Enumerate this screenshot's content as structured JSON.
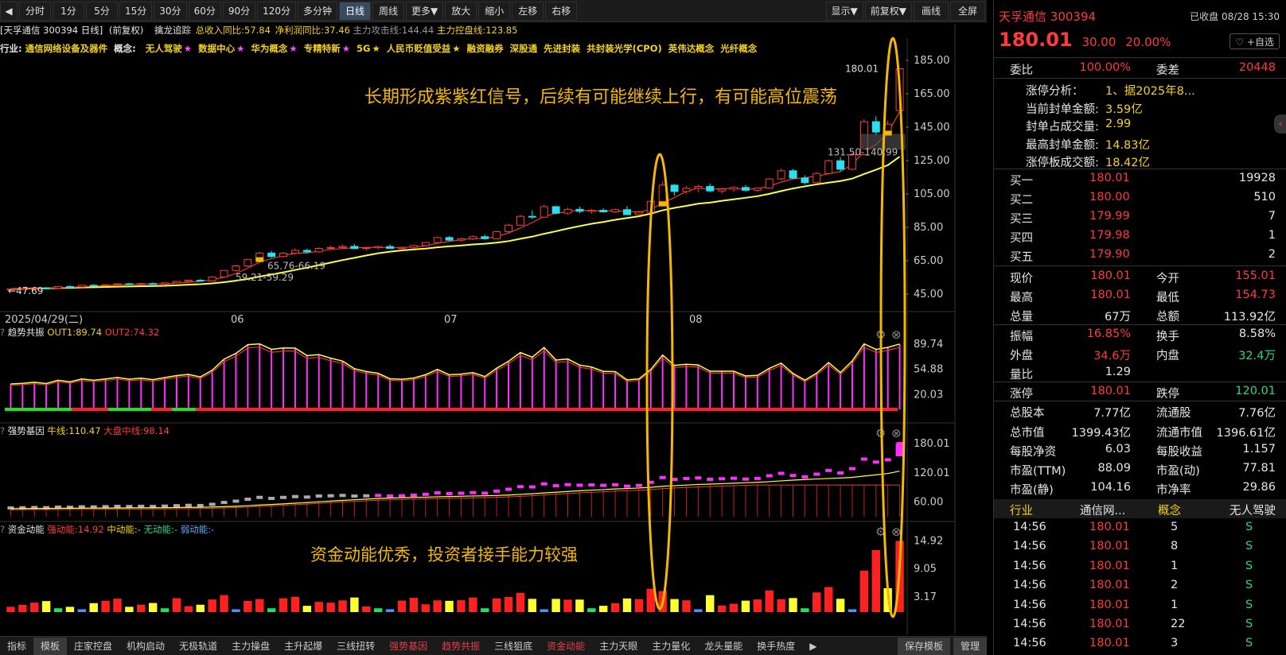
{
  "toolbar": {
    "items": [
      "分时",
      "1分",
      "5分",
      "15分",
      "30分",
      "60分",
      "90分",
      "120分",
      "多分钟",
      "日线",
      "周线",
      "更多▼",
      "放大",
      "缩小",
      "左移",
      "右移"
    ],
    "active": "日线",
    "right_items": [
      "显示▼",
      "前复权▼",
      "画线",
      "全屏"
    ]
  },
  "info": {
    "title": "[天孚通信 300394 日线]",
    "fq": "(前复权)",
    "indicator": "擒龙追踪",
    "rev": "总收入同比:57.84",
    "profit": "净利润同比:37.46",
    "attack": "主力攻击线:144.44",
    "control": "主力控盘线:123.85"
  },
  "categories": {
    "industry_label": "行业:",
    "industry": "通信网络设备及器件",
    "concept_label": "概念:",
    "concepts": [
      {
        "t": "无人驾驶",
        "s": "★",
        "c": "#ff4cff"
      },
      {
        "t": "数据中心",
        "s": "★",
        "c": "#ff4cff"
      },
      {
        "t": "华为概念",
        "s": "★",
        "c": "#ff4cff"
      },
      {
        "t": "专精特新",
        "s": "★",
        "c": "#ff4cff"
      },
      {
        "t": "5G",
        "s": "★",
        "c": "#f5d21a"
      },
      {
        "t": "人民币贬值受益",
        "s": "★",
        "c": "#f5d21a"
      },
      {
        "t": "融资融券",
        "s": "",
        "c": ""
      },
      {
        "t": "深股通",
        "s": "",
        "c": ""
      },
      {
        "t": "先进封装",
        "s": "",
        "c": ""
      },
      {
        "t": "共封装光学(CPO)",
        "s": "",
        "c": ""
      },
      {
        "t": "英伟达概念",
        "s": "",
        "c": ""
      },
      {
        "t": "光纤概念",
        "s": "",
        "c": ""
      }
    ]
  },
  "main_chart": {
    "y_ticks": [
      "185.00",
      "165.00",
      "145.00",
      "125.00",
      "105.00",
      "85.00",
      "65.00",
      "45.00"
    ],
    "x_ticks": [
      "2025/04/29(二)",
      "06",
      "07",
      "08"
    ],
    "annotations": {
      "high": "180.01",
      "box": "131.50-140.99",
      "mid1": "65.76-66.19",
      "mid2": "59.21-59.29",
      "low": "47.69"
    },
    "note": "长期形成紫紫红信号，后续有可能继续上行，有可能高位震荡"
  },
  "chart_data": {
    "type": "candlestick",
    "series": [
      {
        "name": "K",
        "ohlc": [
          [
            47.7,
            48.2,
            47.3,
            48.0
          ],
          [
            48.0,
            48.6,
            47.6,
            48.3
          ],
          [
            48.3,
            49.0,
            47.9,
            48.8
          ],
          [
            48.8,
            49.2,
            48.2,
            48.5
          ],
          [
            48.5,
            49.8,
            48.3,
            49.6
          ],
          [
            49.6,
            50.2,
            49.0,
            49.3
          ],
          [
            49.3,
            50.6,
            49.0,
            50.3
          ],
          [
            50.3,
            51.0,
            49.8,
            50.1
          ],
          [
            50.1,
            50.8,
            49.6,
            50.6
          ],
          [
            50.6,
            51.5,
            50.1,
            51.2
          ],
          [
            51.2,
            51.8,
            50.6,
            50.9
          ],
          [
            50.9,
            51.6,
            50.3,
            51.3
          ],
          [
            51.3,
            52.0,
            50.8,
            51.0
          ],
          [
            51.0,
            51.9,
            50.6,
            51.7
          ],
          [
            51.7,
            52.8,
            51.3,
            52.6
          ],
          [
            52.6,
            53.6,
            52.2,
            53.3
          ],
          [
            53.3,
            54.0,
            52.6,
            52.9
          ],
          [
            52.9,
            55.8,
            52.5,
            55.3
          ],
          [
            55.3,
            59.3,
            55.0,
            59.2
          ],
          [
            59.2,
            62.5,
            58.5,
            61.9
          ],
          [
            61.9,
            66.2,
            61.3,
            65.8
          ],
          [
            65.8,
            70.5,
            65.2,
            69.6
          ],
          [
            69.6,
            71.0,
            66.8,
            67.5
          ],
          [
            67.5,
            70.2,
            66.9,
            69.5
          ],
          [
            69.5,
            72.4,
            68.6,
            71.2
          ],
          [
            71.2,
            72.2,
            69.6,
            70.3
          ],
          [
            70.3,
            73.0,
            69.8,
            72.4
          ],
          [
            72.4,
            74.0,
            71.5,
            72.9
          ],
          [
            72.9,
            74.5,
            72.1,
            73.6
          ],
          [
            73.6,
            75.0,
            72.8,
            72.3
          ],
          [
            72.3,
            73.4,
            71.0,
            72.8
          ],
          [
            72.8,
            74.0,
            71.9,
            73.5
          ],
          [
            73.5,
            74.8,
            72.6,
            72.4
          ],
          [
            72.4,
            73.5,
            71.5,
            73.0
          ],
          [
            73.0,
            74.5,
            72.2,
            74.1
          ],
          [
            74.1,
            76.2,
            73.6,
            75.9
          ],
          [
            75.9,
            79.5,
            75.4,
            78.9
          ],
          [
            78.9,
            79.8,
            76.8,
            77.3
          ],
          [
            77.3,
            78.8,
            76.5,
            78.1
          ],
          [
            78.1,
            80.0,
            77.4,
            79.4
          ],
          [
            79.4,
            80.6,
            77.8,
            78.2
          ],
          [
            78.2,
            82.8,
            77.9,
            82.4
          ],
          [
            82.4,
            87.2,
            82.0,
            86.3
          ],
          [
            86.3,
            92.5,
            85.9,
            91.6
          ],
          [
            91.6,
            95.2,
            90.0,
            91.1
          ],
          [
            91.1,
            98.6,
            90.5,
            97.4
          ],
          [
            97.4,
            98.0,
            92.8,
            93.5
          ],
          [
            93.5,
            96.8,
            92.6,
            95.8
          ],
          [
            95.8,
            97.4,
            93.5,
            94.6
          ],
          [
            94.6,
            96.0,
            93.0,
            95.2
          ],
          [
            95.2,
            96.5,
            93.8,
            94.3
          ],
          [
            94.3,
            96.2,
            93.6,
            95.6
          ],
          [
            95.6,
            97.8,
            94.9,
            92.6
          ],
          [
            92.6,
            95.0,
            91.8,
            94.1
          ],
          [
            94.1,
            101.2,
            93.5,
            100.6
          ],
          [
            100.6,
            112.4,
            98.5,
            110.3
          ],
          [
            110.3,
            111.0,
            104.0,
            106.5
          ],
          [
            106.5,
            109.8,
            105.2,
            108.4
          ],
          [
            108.4,
            110.6,
            106.0,
            109.5
          ],
          [
            109.5,
            111.2,
            105.9,
            106.8
          ],
          [
            106.8,
            108.5,
            105.2,
            107.9
          ],
          [
            107.9,
            109.6,
            106.3,
            108.9
          ],
          [
            108.9,
            110.4,
            106.5,
            107.2
          ],
          [
            107.2,
            109.0,
            106.2,
            108.5
          ],
          [
            108.5,
            114.6,
            108.0,
            114.0
          ],
          [
            114.0,
            120.2,
            113.2,
            118.9
          ],
          [
            118.9,
            120.0,
            113.8,
            114.5
          ],
          [
            114.5,
            116.2,
            110.6,
            111.8
          ],
          [
            111.8,
            118.0,
            111.0,
            117.3
          ],
          [
            117.3,
            125.6,
            116.8,
            124.9
          ],
          [
            124.9,
            127.0,
            118.5,
            119.8
          ],
          [
            119.8,
            129.8,
            119.1,
            128.6
          ],
          [
            128.6,
            149.8,
            128.0,
            148.3
          ],
          [
            148.3,
            151.5,
            140.2,
            142.1
          ],
          [
            142.1,
            149.0,
            141.0,
            146.8
          ],
          [
            155.0,
            180.0,
            154.7,
            180.0
          ]
        ]
      },
      {
        "name": "MA5",
        "values": []
      },
      {
        "name": "MA20",
        "values": []
      }
    ],
    "ylim": [
      40,
      190
    ]
  },
  "panes": {
    "trend": {
      "title": "趋势共振",
      "out1": "OUT1:89.74",
      "out2": "OUT2:74.32",
      "ticks": [
        "89.74",
        "54.88",
        "20.03"
      ]
    },
    "gene": {
      "title": "强势基因",
      "bull": "牛线:110.47",
      "market": "大盘中线:98.14",
      "ticks": [
        "180.01",
        "120.01",
        "60.00"
      ]
    },
    "fund": {
      "title": "资金动能",
      "strong": "强动能:14.92",
      "mid": "中动能:-",
      "none": "无动能:-",
      "weak": "弱动能:-",
      "ticks": [
        "14.92",
        "9.05",
        "3.17"
      ],
      "note": "资金动能优秀，投资者接手能力较强"
    }
  },
  "bottom_tabs": [
    "指标",
    "模板",
    "庄家控盘",
    "机构启动",
    "无极轨道",
    "主力操盘",
    "主升起爆",
    "三线扭转",
    "强势基因",
    "趋势共振",
    "三线狙底",
    "资金动能",
    "主力天眼",
    "主力量化",
    "龙头量能",
    "换手热度"
  ],
  "bottom_red": [
    "强势基因",
    "趋势共振",
    "资金动能"
  ],
  "bottom_right": [
    "保存模板",
    "管理"
  ],
  "quote": {
    "name": "天孚通信",
    "code": "300394",
    "status": "已收盘",
    "time": "08/28 15:30",
    "price": "180.01",
    "change": "30.00",
    "pct": "20.00%",
    "fav": "♡ +自选",
    "webi_label": "委比",
    "webi": "100.00%",
    "wecha_label": "委差",
    "wecha": "20448",
    "limit_analysis": [
      {
        "k": "涨停分析：",
        "v": "1、据2025年8..."
      },
      {
        "k": "当前封单金额:",
        "v": "3.59亿"
      },
      {
        "k": "封单占成交量:",
        "v": "2.99"
      },
      {
        "k": "最高封单金额:",
        "v": "14.83亿"
      },
      {
        "k": "涨停板成交额:",
        "v": "18.42亿"
      }
    ],
    "bids": [
      {
        "k": "买一",
        "p": "180.01",
        "v": "19928"
      },
      {
        "k": "买二",
        "p": "180.00",
        "v": "510"
      },
      {
        "k": "买三",
        "p": "179.99",
        "v": "7"
      },
      {
        "k": "买四",
        "p": "179.98",
        "v": "1"
      },
      {
        "k": "买五",
        "p": "179.90",
        "v": "2"
      }
    ],
    "stats": [
      [
        {
          "k": "现价",
          "v": "180.01",
          "c": "red"
        },
        {
          "k": "今开",
          "v": "155.01",
          "c": "red"
        }
      ],
      [
        {
          "k": "最高",
          "v": "180.01",
          "c": "red"
        },
        {
          "k": "最低",
          "v": "154.73",
          "c": "red"
        }
      ],
      [
        {
          "k": "总量",
          "v": "67万",
          "c": "wht"
        },
        {
          "k": "总额",
          "v": "113.92亿",
          "c": "wht"
        }
      ],
      [
        {
          "k": "振幅",
          "v": "16.85%",
          "c": "red"
        },
        {
          "k": "换手",
          "v": "8.58%",
          "c": "wht"
        }
      ],
      [
        {
          "k": "外盘",
          "v": "34.6万",
          "c": "red"
        },
        {
          "k": "内盘",
          "v": "32.4万",
          "c": "grn"
        }
      ],
      [
        {
          "k": "量比",
          "v": "1.29",
          "c": "wht"
        },
        {
          "k": "",
          "v": "",
          "c": "wht"
        }
      ],
      [
        {
          "k": "涨停",
          "v": "180.01",
          "c": "red"
        },
        {
          "k": "跌停",
          "v": "120.01",
          "c": "grn"
        }
      ],
      [
        {
          "k": "总股本",
          "v": "7.77亿",
          "c": "wht"
        },
        {
          "k": "流通股",
          "v": "7.76亿",
          "c": "wht"
        }
      ],
      [
        {
          "k": "总市值",
          "v": "1399.43亿",
          "c": "wht"
        },
        {
          "k": "流通市值",
          "v": "1396.61亿",
          "c": "wht"
        }
      ],
      [
        {
          "k": "每股净资",
          "v": "6.03",
          "c": "wht"
        },
        {
          "k": "每股收益",
          "v": "1.157",
          "c": "wht"
        }
      ],
      [
        {
          "k": "市盈(TTM)",
          "v": "88.09",
          "c": "wht"
        },
        {
          "k": "市盈(动)",
          "v": "77.81",
          "c": "wht"
        }
      ],
      [
        {
          "k": "市盈(静)",
          "v": "104.16",
          "c": "wht"
        },
        {
          "k": "市净率",
          "v": "29.86",
          "c": "wht"
        }
      ]
    ],
    "industry_row": {
      "k1": "行业",
      "v1": "通信网...",
      "k2": "概念",
      "v2": "无人驾驶"
    },
    "ticks": [
      {
        "t": "14:56",
        "p": "180.01",
        "v": "5",
        "d": "S"
      },
      {
        "t": "14:56",
        "p": "180.01",
        "v": "8",
        "d": "S"
      },
      {
        "t": "14:56",
        "p": "180.01",
        "v": "1",
        "d": "S"
      },
      {
        "t": "14:56",
        "p": "180.01",
        "v": "2",
        "d": "S"
      },
      {
        "t": "14:56",
        "p": "180.01",
        "v": "1",
        "d": "S"
      },
      {
        "t": "14:56",
        "p": "180.01",
        "v": "22",
        "d": "S"
      },
      {
        "t": "14:56",
        "p": "180.01",
        "v": "3",
        "d": "S"
      }
    ]
  }
}
